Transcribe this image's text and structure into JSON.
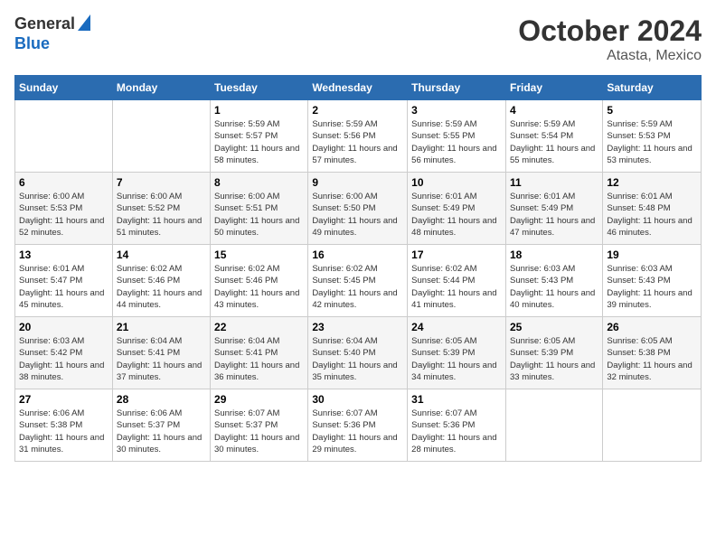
{
  "logo": {
    "general": "General",
    "blue": "Blue"
  },
  "header": {
    "month": "October 2024",
    "location": "Atasta, Mexico"
  },
  "weekdays": [
    "Sunday",
    "Monday",
    "Tuesday",
    "Wednesday",
    "Thursday",
    "Friday",
    "Saturday"
  ],
  "weeks": [
    [
      {
        "day": "",
        "info": ""
      },
      {
        "day": "",
        "info": ""
      },
      {
        "day": "1",
        "info": "Sunrise: 5:59 AM\nSunset: 5:57 PM\nDaylight: 11 hours and 58 minutes."
      },
      {
        "day": "2",
        "info": "Sunrise: 5:59 AM\nSunset: 5:56 PM\nDaylight: 11 hours and 57 minutes."
      },
      {
        "day": "3",
        "info": "Sunrise: 5:59 AM\nSunset: 5:55 PM\nDaylight: 11 hours and 56 minutes."
      },
      {
        "day": "4",
        "info": "Sunrise: 5:59 AM\nSunset: 5:54 PM\nDaylight: 11 hours and 55 minutes."
      },
      {
        "day": "5",
        "info": "Sunrise: 5:59 AM\nSunset: 5:53 PM\nDaylight: 11 hours and 53 minutes."
      }
    ],
    [
      {
        "day": "6",
        "info": "Sunrise: 6:00 AM\nSunset: 5:53 PM\nDaylight: 11 hours and 52 minutes."
      },
      {
        "day": "7",
        "info": "Sunrise: 6:00 AM\nSunset: 5:52 PM\nDaylight: 11 hours and 51 minutes."
      },
      {
        "day": "8",
        "info": "Sunrise: 6:00 AM\nSunset: 5:51 PM\nDaylight: 11 hours and 50 minutes."
      },
      {
        "day": "9",
        "info": "Sunrise: 6:00 AM\nSunset: 5:50 PM\nDaylight: 11 hours and 49 minutes."
      },
      {
        "day": "10",
        "info": "Sunrise: 6:01 AM\nSunset: 5:49 PM\nDaylight: 11 hours and 48 minutes."
      },
      {
        "day": "11",
        "info": "Sunrise: 6:01 AM\nSunset: 5:49 PM\nDaylight: 11 hours and 47 minutes."
      },
      {
        "day": "12",
        "info": "Sunrise: 6:01 AM\nSunset: 5:48 PM\nDaylight: 11 hours and 46 minutes."
      }
    ],
    [
      {
        "day": "13",
        "info": "Sunrise: 6:01 AM\nSunset: 5:47 PM\nDaylight: 11 hours and 45 minutes."
      },
      {
        "day": "14",
        "info": "Sunrise: 6:02 AM\nSunset: 5:46 PM\nDaylight: 11 hours and 44 minutes."
      },
      {
        "day": "15",
        "info": "Sunrise: 6:02 AM\nSunset: 5:46 PM\nDaylight: 11 hours and 43 minutes."
      },
      {
        "day": "16",
        "info": "Sunrise: 6:02 AM\nSunset: 5:45 PM\nDaylight: 11 hours and 42 minutes."
      },
      {
        "day": "17",
        "info": "Sunrise: 6:02 AM\nSunset: 5:44 PM\nDaylight: 11 hours and 41 minutes."
      },
      {
        "day": "18",
        "info": "Sunrise: 6:03 AM\nSunset: 5:43 PM\nDaylight: 11 hours and 40 minutes."
      },
      {
        "day": "19",
        "info": "Sunrise: 6:03 AM\nSunset: 5:43 PM\nDaylight: 11 hours and 39 minutes."
      }
    ],
    [
      {
        "day": "20",
        "info": "Sunrise: 6:03 AM\nSunset: 5:42 PM\nDaylight: 11 hours and 38 minutes."
      },
      {
        "day": "21",
        "info": "Sunrise: 6:04 AM\nSunset: 5:41 PM\nDaylight: 11 hours and 37 minutes."
      },
      {
        "day": "22",
        "info": "Sunrise: 6:04 AM\nSunset: 5:41 PM\nDaylight: 11 hours and 36 minutes."
      },
      {
        "day": "23",
        "info": "Sunrise: 6:04 AM\nSunset: 5:40 PM\nDaylight: 11 hours and 35 minutes."
      },
      {
        "day": "24",
        "info": "Sunrise: 6:05 AM\nSunset: 5:39 PM\nDaylight: 11 hours and 34 minutes."
      },
      {
        "day": "25",
        "info": "Sunrise: 6:05 AM\nSunset: 5:39 PM\nDaylight: 11 hours and 33 minutes."
      },
      {
        "day": "26",
        "info": "Sunrise: 6:05 AM\nSunset: 5:38 PM\nDaylight: 11 hours and 32 minutes."
      }
    ],
    [
      {
        "day": "27",
        "info": "Sunrise: 6:06 AM\nSunset: 5:38 PM\nDaylight: 11 hours and 31 minutes."
      },
      {
        "day": "28",
        "info": "Sunrise: 6:06 AM\nSunset: 5:37 PM\nDaylight: 11 hours and 30 minutes."
      },
      {
        "day": "29",
        "info": "Sunrise: 6:07 AM\nSunset: 5:37 PM\nDaylight: 11 hours and 30 minutes."
      },
      {
        "day": "30",
        "info": "Sunrise: 6:07 AM\nSunset: 5:36 PM\nDaylight: 11 hours and 29 minutes."
      },
      {
        "day": "31",
        "info": "Sunrise: 6:07 AM\nSunset: 5:36 PM\nDaylight: 11 hours and 28 minutes."
      },
      {
        "day": "",
        "info": ""
      },
      {
        "day": "",
        "info": ""
      }
    ]
  ]
}
